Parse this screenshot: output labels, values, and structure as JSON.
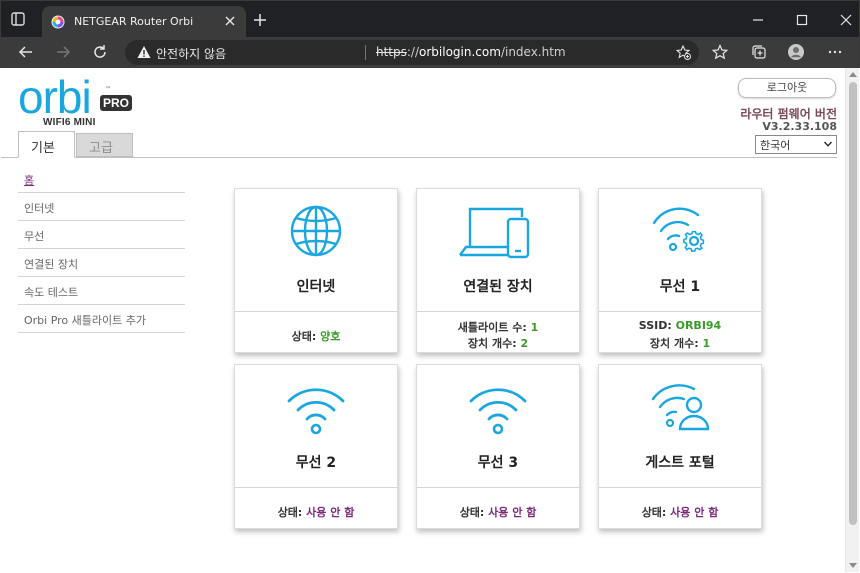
{
  "browser": {
    "tab_title": "NETGEAR Router Orbi",
    "security_text": "안전하지 않음",
    "url_scheme": "https",
    "url_separator": "://",
    "url_host": "orbilogin.com",
    "url_path": "/index.htm"
  },
  "header": {
    "logo_text": "orbi",
    "logo_badge": "PRO",
    "logo_tm": "™",
    "logo_sub": "WIFI6 MINI",
    "logout_label": "로그아웃",
    "firmware_label": "라우터 펌웨어 버전",
    "firmware_version": "V3.2.33.108",
    "language_selected": "한국어"
  },
  "tabs": [
    {
      "label": "기본",
      "active": true
    },
    {
      "label": "고급",
      "active": false
    }
  ],
  "sidebar": {
    "items": [
      {
        "label": "홈",
        "active": true
      },
      {
        "label": "인터넷"
      },
      {
        "label": "무선"
      },
      {
        "label": "연결된 장치"
      },
      {
        "label": "속도 테스트"
      },
      {
        "label": "Orbi Pro 새틀라이트 추가"
      }
    ]
  },
  "cards": {
    "internet": {
      "title": "인터넷",
      "status_label": "상태:",
      "status_value": "양호"
    },
    "devices": {
      "title": "연결된 장치",
      "sat_label": "새틀라이트 수:",
      "sat_value": "1",
      "dev_label": "장치 개수:",
      "dev_value": "2"
    },
    "wireless1": {
      "title": "무선 1",
      "ssid_label": "SSID:",
      "ssid_value": "ORBI94",
      "dev_label": "장치 개수:",
      "dev_value": "1"
    },
    "wireless2": {
      "title": "무선 2",
      "status_label": "상태:",
      "status_value": "사용 안 함"
    },
    "wireless3": {
      "title": "무선 3",
      "status_label": "상태:",
      "status_value": "사용 안 함"
    },
    "guest": {
      "title": "게스트 포털",
      "status_label": "상태:",
      "status_value": "사용 안 함"
    }
  },
  "colors": {
    "accent_blue": "#1aa7e0",
    "status_green": "#3a9a2a",
    "status_purple": "#7b2a7a"
  }
}
